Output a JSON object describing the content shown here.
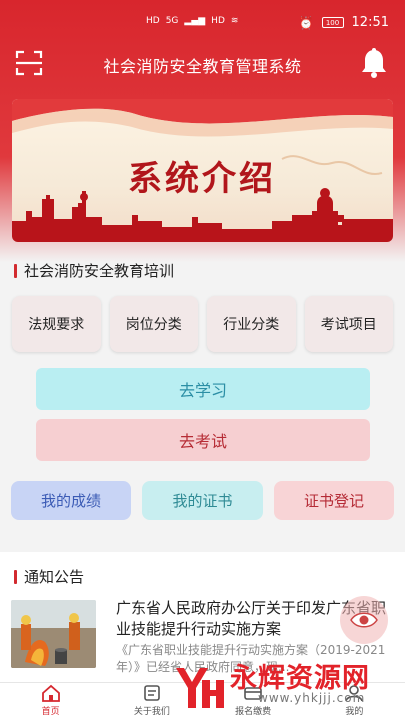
{
  "status_bar": {
    "left_indicators": [
      "HD",
      "5G",
      "HD"
    ],
    "battery": "100",
    "time": "12:51"
  },
  "header": {
    "title": "社会消防安全教育管理系统",
    "scan_icon": "scan-icon",
    "bell_icon": "bell-icon"
  },
  "banner": {
    "title": "系统介绍"
  },
  "training": {
    "section_label": "社会消防安全教育培训",
    "categories": [
      "法规要求",
      "岗位分类",
      "行业分类",
      "考试项目"
    ],
    "learn_button": "去学习",
    "exam_button": "去考试",
    "my_score": "我的成绩",
    "my_certificate": "我的证书",
    "certificate_register": "证书登记"
  },
  "notices": {
    "section_label": "通知公告",
    "items": [
      {
        "title": "广东省人民政府办公厅关于印发广东省职业技能提升行动实施方案",
        "desc": "《广东省职业技能提升行动实施方案（2019-2021年）》已经省人民政府同意，现..."
      }
    ]
  },
  "tabbar": {
    "tabs": [
      {
        "label": "首页",
        "icon": "home-icon",
        "active": true
      },
      {
        "label": "关于我们",
        "icon": "about-icon",
        "active": false
      },
      {
        "label": "报名缴费",
        "icon": "payment-icon",
        "active": false
      },
      {
        "label": "我的",
        "icon": "profile-icon",
        "active": false
      }
    ]
  },
  "watermark": {
    "text": "永辉资源网",
    "url": "www.yhkjjj.com"
  },
  "colors": {
    "primary_red": "#d8262d",
    "learn_bg": "#b9eef2",
    "exam_bg": "#f6cfd1"
  }
}
